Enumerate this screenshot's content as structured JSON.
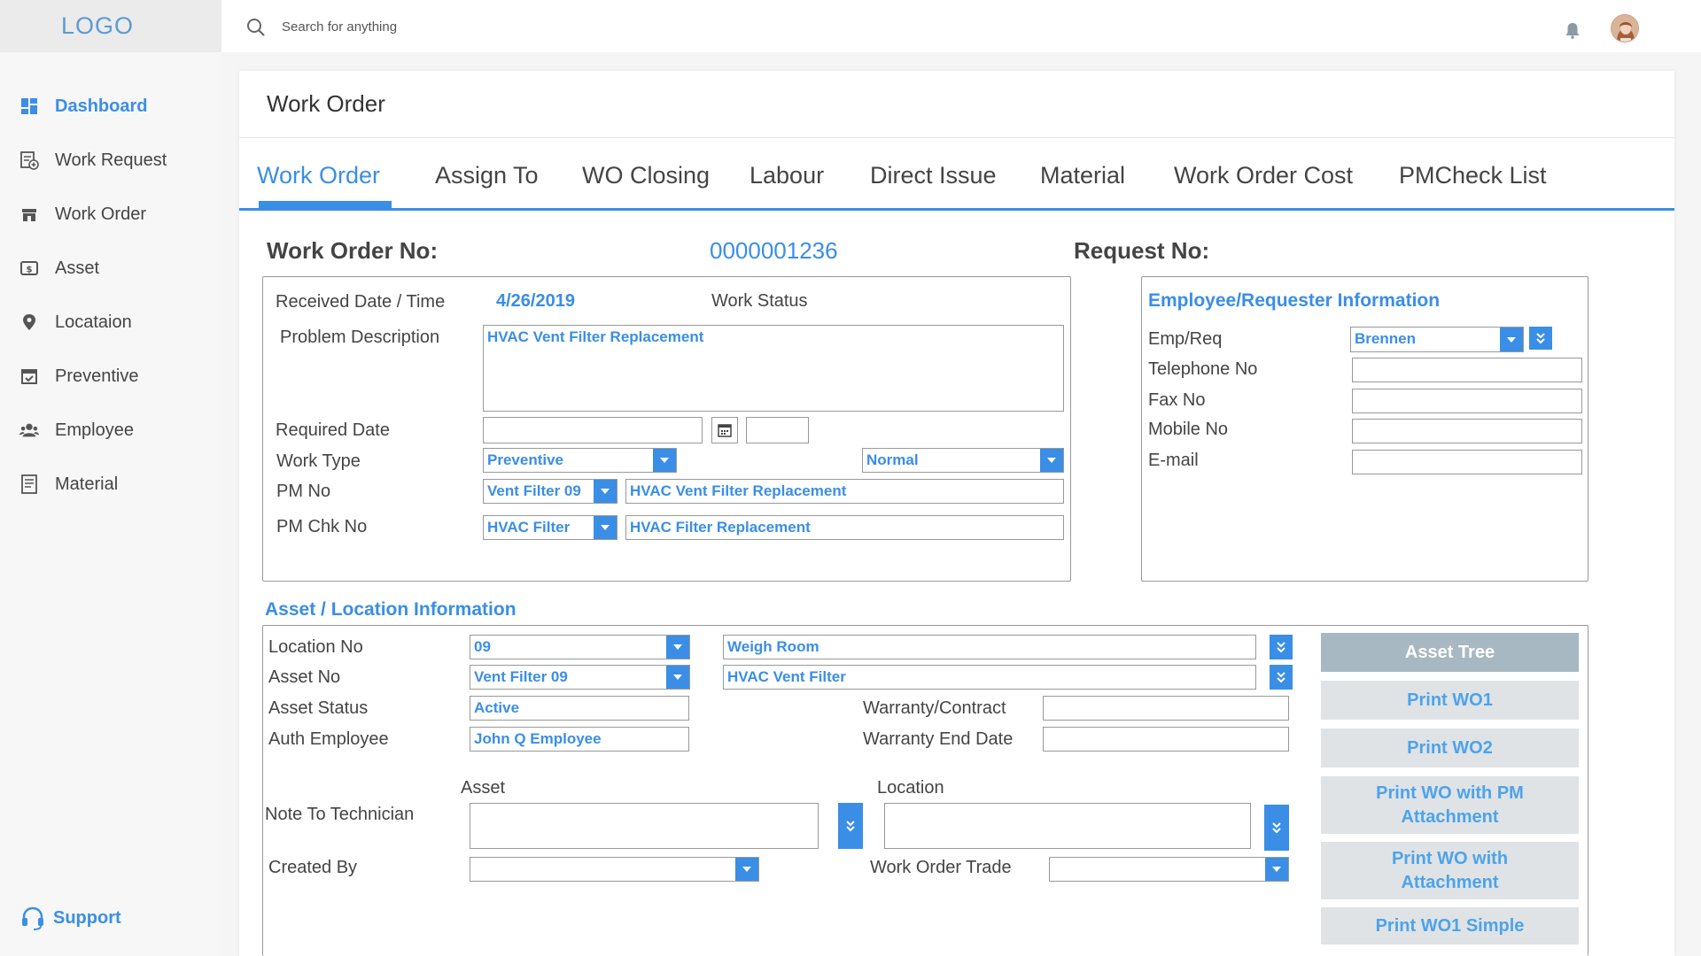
{
  "app": {
    "logo": "LOGO"
  },
  "search": {
    "placeholder": "Search for anything"
  },
  "sidebar": {
    "items": [
      {
        "label": "Dashboard",
        "icon": "dashboard-icon"
      },
      {
        "label": "Work Request",
        "icon": "work-request-icon"
      },
      {
        "label": "Work Order",
        "icon": "work-order-icon"
      },
      {
        "label": "Asset",
        "icon": "asset-icon"
      },
      {
        "label": "Locataion",
        "icon": "location-pin-icon"
      },
      {
        "label": "Preventive",
        "icon": "calendar-icon"
      },
      {
        "label": "Employee",
        "icon": "people-icon"
      },
      {
        "label": "Material",
        "icon": "document-icon"
      }
    ],
    "support": "Support"
  },
  "page": {
    "title": "Work Order",
    "tabs": [
      "Work Order",
      "Assign To",
      "WO Closing",
      "Labour",
      "Direct Issue",
      "Material",
      "Work Order Cost",
      "PMCheck List"
    ]
  },
  "header": {
    "wo_no_label": "Work Order No:",
    "wo_no_value": "0000001236",
    "request_no_label": "Request No:"
  },
  "wo_details": {
    "received_label": "Received Date / Time",
    "received_value": "4/26/2019",
    "work_status_label": "Work Status",
    "problem_label": "Problem Description",
    "problem_value": "HVAC Vent Filter Replacement",
    "required_date_label": "Required Date",
    "work_type_label": "Work Type",
    "work_type_value": "Preventive",
    "priority_value": "Normal",
    "pm_no_label": "PM No",
    "pm_no_value": "Vent Filter 09",
    "pm_no_desc": "HVAC Vent Filter Replacement",
    "pm_chk_label": "PM Chk No",
    "pm_chk_value": "HVAC Filter",
    "pm_chk_desc": "HVAC Filter Replacement"
  },
  "employee": {
    "title": "Employee/Requester Information",
    "emp_label": "Emp/Req",
    "emp_value": "Brennen",
    "tel_label": "Telephone No",
    "fax_label": "Fax No",
    "mobile_label": "Mobile No",
    "email_label": "E-mail"
  },
  "asset": {
    "title": "Asset / Location Information",
    "location_no_label": "Location No",
    "location_no_value": "09",
    "location_desc": "Weigh Room",
    "asset_no_label": "Asset No",
    "asset_no_value": "Vent Filter 09",
    "asset_desc": "HVAC Vent Filter",
    "asset_status_label": "Asset Status",
    "asset_status_value": "Active",
    "auth_emp_label": "Auth Employee",
    "auth_emp_value": "John Q Employee",
    "warranty_label": "Warranty/Contract",
    "warranty_end_label": "Warranty End Date",
    "note_label": "Note To Technician",
    "note_asset_label": "Asset",
    "note_location_label": "Location",
    "created_by_label": "Created By",
    "trade_label": "Work Order Trade"
  },
  "actions": {
    "asset_tree": "Asset Tree",
    "print_wo1": "Print WO1",
    "print_wo2": "Print WO2",
    "print_wo_pm": "Print WO with PM Attachment",
    "print_wo_att": "Print WO with Attachment",
    "print_wo1_simple": "Print WO1 Simple"
  },
  "colors": {
    "accent": "#3a8ee6",
    "button_bg": "#dfe3e6",
    "button_dark": "#a8b8c2"
  }
}
